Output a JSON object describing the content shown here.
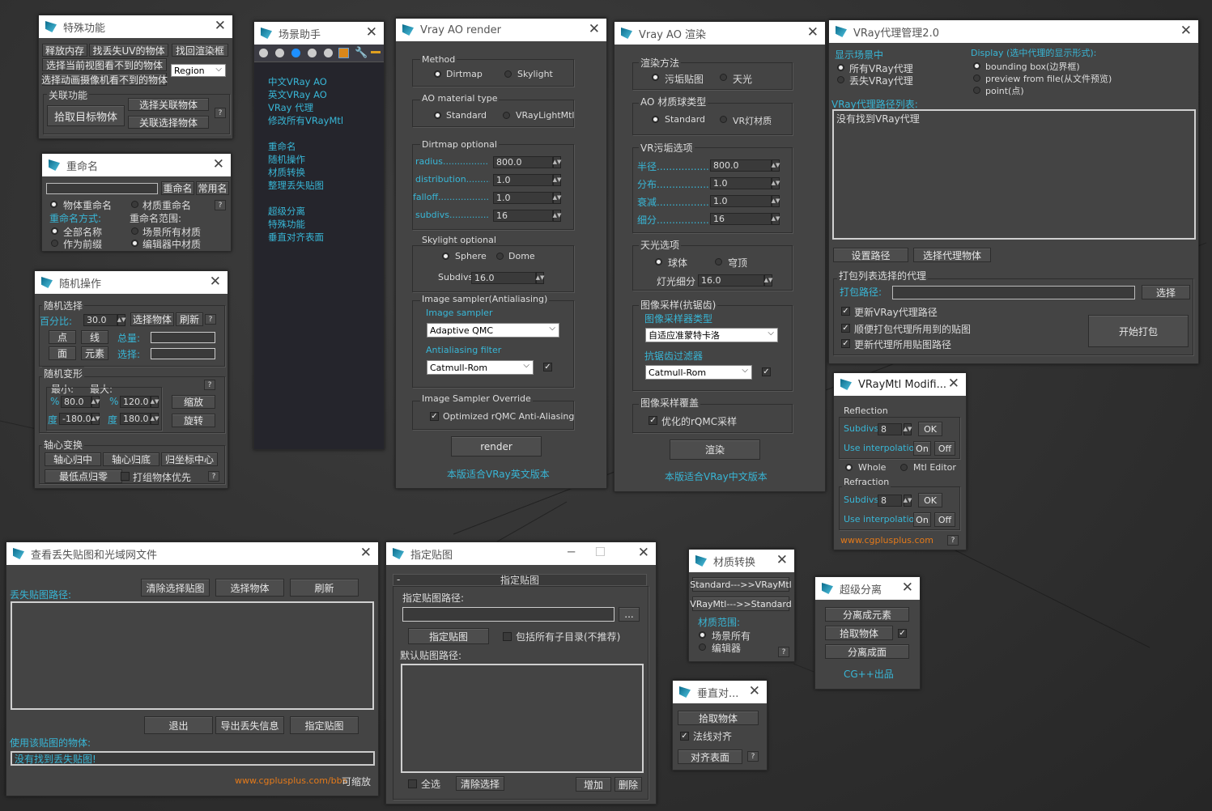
{
  "w1": {
    "title": "特殊功能",
    "b1": "释放内存",
    "b2": "找丢失UV的物体",
    "b3": "找回渲染框",
    "b4": "选择当前视图看不到的物体",
    "region": "Region",
    "b5": "选择动画摄像机看不到的物体",
    "g1": "关联功能",
    "b6": "拾取目标物体",
    "b7": "选择关联物体",
    "b8": "关联选择物体",
    "help": "?"
  },
  "w2": {
    "title": "重命名",
    "b1": "重命名",
    "b2": "常用名",
    "r1": "物体重命名",
    "r2": "材质重命名",
    "help": "?",
    "l1": "重命名方式:",
    "l2": "重命名范围:",
    "r3": "全部名称",
    "r4": "场景所有材质",
    "r5": "作为前缀",
    "r6": "编辑器中材质"
  },
  "w3": {
    "title": "随机操作",
    "g1": "随机选择",
    "pct": "百分比:",
    "pctv": "30.0",
    "b1": "选择物体",
    "b2": "刷新",
    "help": "?",
    "b3": "点",
    "b4": "线",
    "tot": "总量:",
    "b5": "面",
    "b6": "元素",
    "selv": "选择:",
    "g2": "随机变形",
    "min": "最小:",
    "max": "最大:",
    "p": "%",
    "v1": "80.0",
    "v2": "120.0",
    "d": "度",
    "v3": "-180.0",
    "v4": "180.0",
    "b7": "缩放",
    "b8": "旋转",
    "g3": "轴心变换",
    "b9": "轴心归中",
    "b10": "轴心归底",
    "b11": "归坐标中心",
    "b12": "最低点归零",
    "c1": "打组物体优先"
  },
  "w4": {
    "title": "场景助手",
    "links": [
      "中文VRay AO",
      "英文VRay AO",
      "VRay 代理",
      "修改所有VRayMtl"
    ],
    "links2": [
      "重命名",
      "随机操作",
      "材质转换",
      "整理丢失贴图"
    ],
    "links3": [
      "超级分离",
      "特殊功能",
      "垂直对齐表面"
    ]
  },
  "w5": {
    "title": "Vray AO render",
    "g1": "Method",
    "r1": "Dirtmap",
    "r2": "Skylight",
    "g2": "AO material type",
    "r3": "Standard",
    "r4": "VRayLightMtl",
    "g3": "Dirtmap optional",
    "l1": "radius................",
    "v1": "800.0",
    "l2": "distribution.........",
    "v2": "1.0",
    "l3": "falloff..................",
    "v3": "1.0",
    "l4": "subdivs..............",
    "v4": "16",
    "g4": "Skylight optional",
    "r5": "Sphere",
    "r6": "Dome",
    "l5": "Subdivs",
    "v5": "16.0",
    "g5": "Image sampler(Antialiasing)",
    "l6": "Image sampler",
    "s1": "Adaptive QMC",
    "l7": "Antialiasing filter",
    "s2": "Catmull-Rom",
    "g6": "Image Sampler Override",
    "c1": "Optimized rQMC Anti-Aliasing",
    "b1": "render",
    "foot": "本版适合VRay英文版本"
  },
  "w6": {
    "title": "Vray AO 渲染",
    "g1": "渲染方法",
    "r1": "污垢贴图",
    "r2": "天光",
    "g2": "AO 材质球类型",
    "r3": "Standard",
    "r4": "VR灯材质",
    "g3": "VR污垢选项",
    "l1": "半径..................",
    "v1": "800.0",
    "l2": "分布..................",
    "v2": "1.0",
    "l3": "衰减..................",
    "v3": "1.0",
    "l4": "细分..................",
    "v4": "16",
    "g4": "天光选项",
    "r5": "球体",
    "r6": "穹顶",
    "l5": "灯光细分",
    "v5": "16.0",
    "g5": "图像采样(抗锯齿)",
    "l6": "图像采样器类型",
    "s1": "自适应准蒙特卡洛",
    "l7": "抗锯齿过滤器",
    "s2": "Catmull-Rom",
    "g6": "图像采样覆盖",
    "c1": "优化的rQMC采样",
    "b1": "渲染",
    "foot": "本版适合VRay中文版本"
  },
  "w7": {
    "title": "VRay代理管理2.0",
    "l1": "显示场景中",
    "r1": "所有VRay代理",
    "r2": "丢失VRay代理",
    "l2": "Display (选中代理的显示形式):",
    "r3": "bounding box(边界框)",
    "r4": "preview from file(从文件预览)",
    "r5": "point(点)",
    "l3": "VRay代理路径列表:",
    "list": "没有找到VRay代理",
    "b1": "设置路径",
    "b2": "选择代理物体",
    "g1": "打包列表选择的代理",
    "l4": "打包路径:",
    "b3": "选择",
    "c1": "更新VRay代理路径",
    "c2": "顺便打包代理所用到的贴图",
    "c3": "更新代理所用贴图路径",
    "b4": "开始打包"
  },
  "w8": {
    "title": "VRayMtl Modifi...",
    "g1": "Reflection",
    "l1": "Subdivs",
    "v1": "8",
    "ok": "OK",
    "l2": "Use interpolation",
    "on": "On",
    "off": "Off",
    "r1": "Whole",
    "r2": "Mtl Editor",
    "g2": "Refraction",
    "url": "www.cgplusplus.com",
    "help": "?"
  },
  "w9": {
    "title": "查看丢失贴图和光域网文件",
    "b1": "清除选择贴图",
    "b2": "选择物体",
    "b3": "刷新",
    "l1": "丢失贴图路径:",
    "b4": "退出",
    "b5": "导出丢失信息",
    "b6": "指定贴图",
    "l2": "使用该贴图的物体:",
    "v1": "没有找到丢失贴图!",
    "url": "www.cgplusplus.com/bbs",
    "zoom": "可缩放"
  },
  "w10": {
    "title": "指定贴图",
    "bar": "指定贴图",
    "minus": "-",
    "l1": "指定贴图路径:",
    "dots": "...",
    "b1": "指定贴图",
    "c1": "包括所有子目录(不推荐)",
    "l2": "默认贴图路径:",
    "c2": "全选",
    "b2": "清除选择",
    "b3": "增加",
    "b4": "删除"
  },
  "w11": {
    "title": "材质转换",
    "b1": "Standard--->>VRayMtl",
    "b2": "VRayMtl--->>Standard",
    "l1": "材质范围:",
    "r1": "场景所有",
    "r2": "编辑器",
    "help": "?"
  },
  "w12": {
    "title": "超级分离",
    "b1": "分离成元素",
    "b2": "拾取物体",
    "b3": "分离成面",
    "foot": "CG++出品"
  },
  "w13": {
    "title": "垂直对...",
    "b1": "拾取物体",
    "c1": "法线对齐",
    "b2": "对齐表面",
    "help": "?"
  }
}
